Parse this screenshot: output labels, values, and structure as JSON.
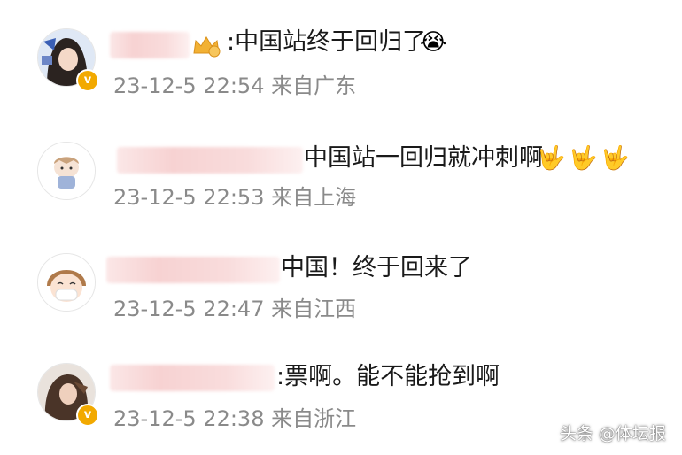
{
  "comments": [
    {
      "text": ":中国站终于回归了",
      "time": "23-12-5 22:54",
      "location": "来自广东",
      "badge_icon": "crown-badge-icon",
      "emojis": [
        "😭"
      ],
      "verified": true
    },
    {
      "text": "中国站一回归就冲刺啊",
      "time": "23-12-5 22:53",
      "location": "来自上海",
      "badge_icon": "",
      "emojis": [
        "🤟",
        "🤟",
        "🤟"
      ],
      "verified": false
    },
    {
      "text": "中国！终于回来了",
      "time": "23-12-5 22:47",
      "location": "来自江西",
      "badge_icon": "",
      "emojis": [],
      "verified": false
    },
    {
      "text": ":票啊。能不能抢到啊",
      "time": "23-12-5 22:38",
      "location": "来自浙江",
      "badge_icon": "",
      "emojis": [],
      "verified": true
    }
  ],
  "watermark": "头条 @体坛报"
}
